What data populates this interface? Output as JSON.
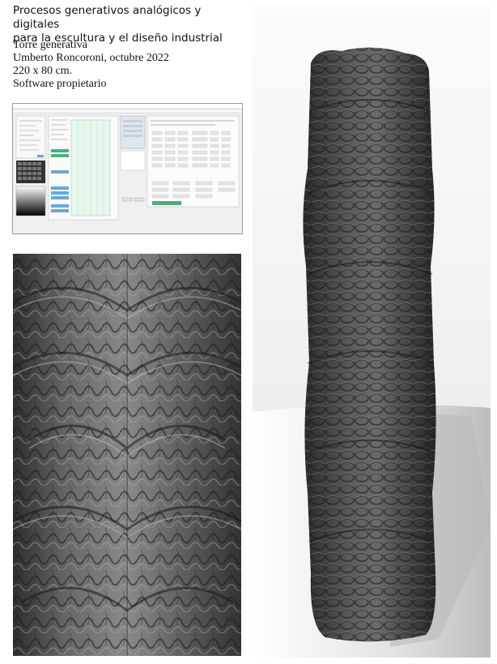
{
  "header": {
    "title_line1": "Procesos generativos analógicos y digitales",
    "title_line2": "para la escultura y el diseño industrial"
  },
  "work": {
    "name": "Torre generativa",
    "author_date": "Umberto Roncoroni, octubre 2022",
    "dimensions": "220 x 80 cm.",
    "software": "Software propietario"
  },
  "images": {
    "software_screenshot": "software-window-screenshot",
    "texture_detail": "sculpted-surface-detail",
    "tower_render": "generative-tower-render"
  },
  "colors": {
    "background": "#ffffff",
    "text": "#111111",
    "ui_green": "#4caf7a",
    "ui_blue": "#6aa7d8"
  }
}
